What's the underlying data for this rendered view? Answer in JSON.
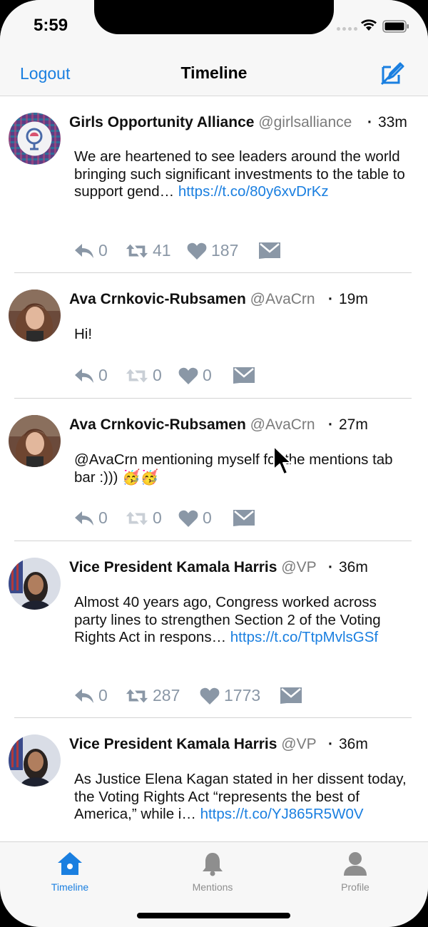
{
  "status_bar": {
    "time": "5:59"
  },
  "nav": {
    "left_button": "Logout",
    "title": "Timeline",
    "compose_icon": "compose-icon"
  },
  "tweets": [
    {
      "name": "Girls Opportunity Alliance",
      "handle": "@girlsalliance",
      "time": "33m",
      "text": "We are heartened to see leaders around the world bringing such significant investments to the table to support gend…",
      "link": "https://t.co/80y6xvDrKz",
      "replies": "0",
      "retweets": "41",
      "likes": "187",
      "retweet_active": true
    },
    {
      "name": "Ava Crnkovic-Rubsamen",
      "handle": "@AvaCrn",
      "time": "19m",
      "text": "Hi!",
      "link": "",
      "replies": "0",
      "retweets": "0",
      "likes": "0",
      "retweet_active": false
    },
    {
      "name": "Ava Crnkovic-Rubsamen",
      "handle": "@AvaCrn",
      "time": "27m",
      "text": "@AvaCrn mentioning myself for the mentions tab bar :))) 🥳🥳",
      "link": "",
      "replies": "0",
      "retweets": "0",
      "likes": "0",
      "retweet_active": false
    },
    {
      "name": "Vice President Kamala Harris",
      "handle": "@VP",
      "time": "36m",
      "text": "Almost 40 years ago, Congress worked across party lines to strengthen Section 2 of the Voting Rights Act in respons…",
      "link": "https://t.co/TtpMvlsGSf",
      "replies": "0",
      "retweets": "287",
      "likes": "1773",
      "retweet_active": true
    },
    {
      "name": "Vice President Kamala Harris",
      "handle": "@VP",
      "time": "36m",
      "text": "As Justice Elena Kagan stated in her dissent today, the Voting Rights Act “represents the best of America,” while i…",
      "link": "https://t.co/YJ865R5W0V",
      "replies": "",
      "retweets": "",
      "likes": "",
      "retweet_active": true
    }
  ],
  "tab_bar": {
    "tabs": [
      {
        "label": "Timeline",
        "icon": "home-icon",
        "active": true
      },
      {
        "label": "Mentions",
        "icon": "bell-icon",
        "active": false
      },
      {
        "label": "Profile",
        "icon": "person-icon",
        "active": false
      }
    ]
  },
  "colors": {
    "accent": "#1a7fe0",
    "action_gray": "#8a97a6",
    "handle_gray": "#7b7b7b",
    "bar_background": "#f7f7f7"
  }
}
